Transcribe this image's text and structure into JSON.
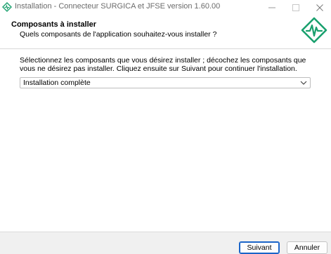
{
  "window": {
    "title": "Installation - Connecteur SURGICA et JFSE version 1.60.00"
  },
  "header": {
    "title": "Composants à installer",
    "subtitle": "Quels composants de l'application souhaitez-vous installer ?"
  },
  "content": {
    "instructions": "Sélectionnez les composants que vous désirez installer ; décochez les composants que vous ne désirez pas installer. Cliquez ensuite sur Suivant pour continuer l'installation.",
    "components_select": {
      "selected": "Installation complète"
    }
  },
  "footer": {
    "next_label": "Suivant",
    "cancel_label": "Annuler"
  },
  "colors": {
    "brand": "#1aa06e",
    "focus": "#1a64c8"
  }
}
